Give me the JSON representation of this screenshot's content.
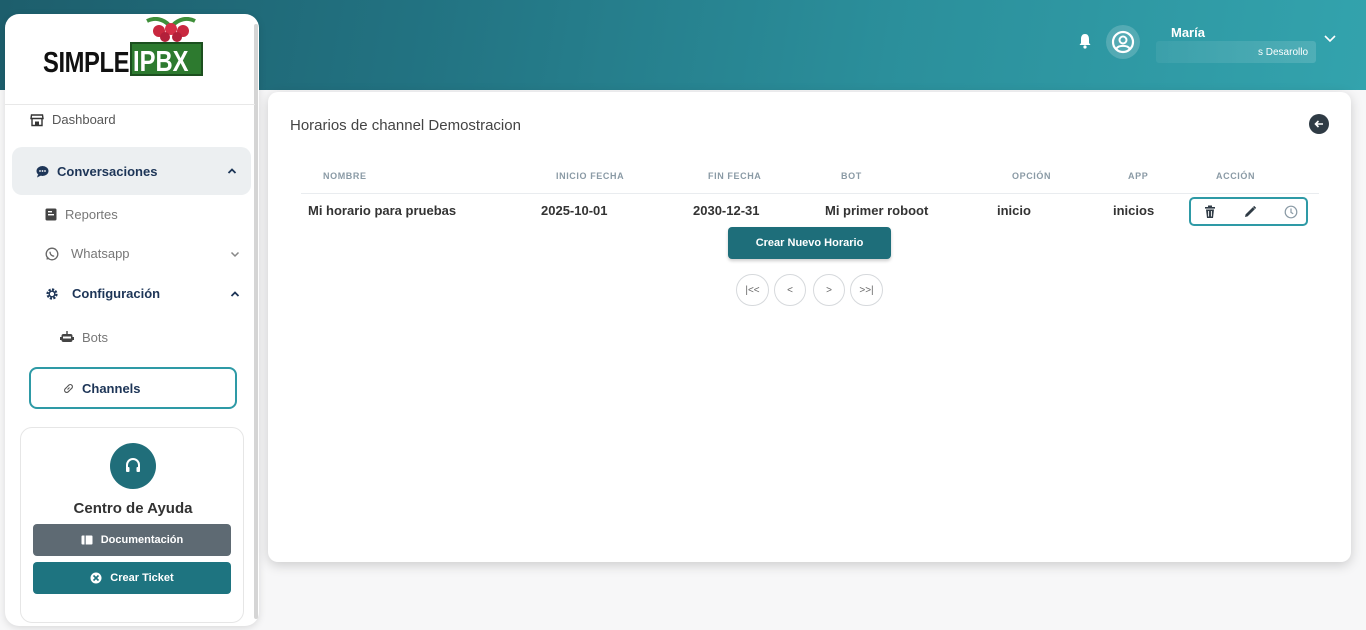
{
  "header": {
    "user_name": "María",
    "user_role": "s Desarollo",
    "bell_icon": "bell-icon",
    "avatar_icon": "user-circle-icon",
    "menu_icon": "chevron-down-icon"
  },
  "brand": {
    "word1": "SIMPLE",
    "word2": "IPBX",
    "colors": {
      "topbar_start": "#1d5e6c",
      "topbar_end": "#33a3ad",
      "accent": "#2e9aa6",
      "primary_button": "#1e6e7a"
    }
  },
  "sidebar": {
    "dashboard": "Dashboard",
    "conversaciones": "Conversaciones",
    "reportes": "Reportes",
    "whatsapp": "Whatsapp",
    "configuracion": "Configuración",
    "bots": "Bots",
    "channels": "Channels",
    "help": {
      "title": "Centro de Ayuda",
      "doc_button": "Documentación",
      "ticket_button": "Crear Ticket"
    }
  },
  "main": {
    "title": "Horarios de channel Demostracion",
    "columns": [
      "NOMBRE",
      "INICIO FECHA",
      "FIN FECHA",
      "BOT",
      "OPCIÓN",
      "APP",
      "ACCIÓN"
    ],
    "rows": [
      {
        "nombre": "Mi horario para pruebas",
        "inicio": "2025-10-01",
        "fin": "2030-12-31",
        "bot": "Mi primer roboot",
        "opcion": "inicio",
        "app": "inicios"
      }
    ],
    "new_button": "Crear Nuevo Horario",
    "pagination": {
      "first": "|<<",
      "prev": "<",
      "next": ">",
      "last": ">>|"
    }
  }
}
